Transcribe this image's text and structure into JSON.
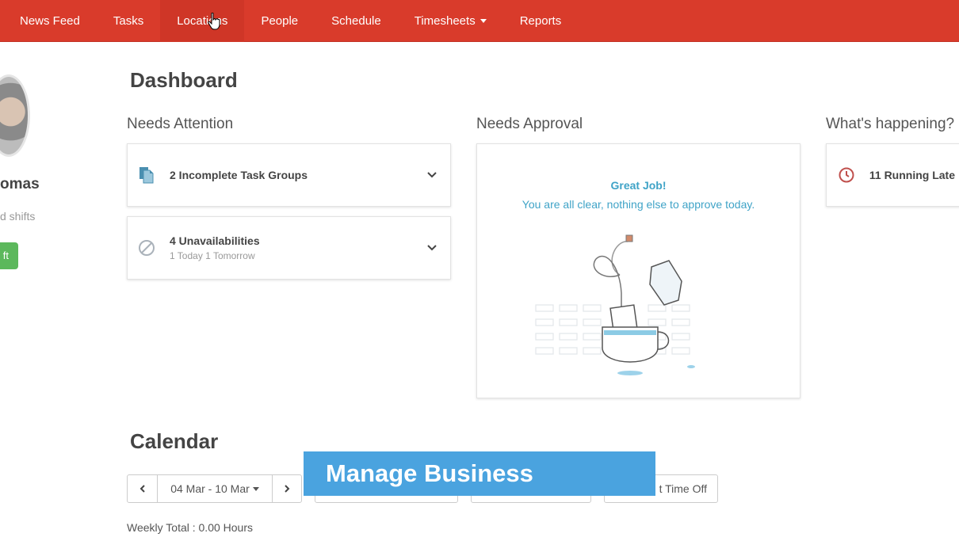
{
  "nav": {
    "items": [
      {
        "label": "News Feed"
      },
      {
        "label": "Tasks"
      },
      {
        "label": "Locations"
      },
      {
        "label": "People"
      },
      {
        "label": "Schedule"
      },
      {
        "label": "Timesheets"
      },
      {
        "label": "Reports"
      }
    ],
    "active": "Locations",
    "accent_color": "#d93b2b"
  },
  "profile": {
    "name_fragment": "omas",
    "sub_fragment": "d shifts",
    "button_fragment": "ft"
  },
  "dashboard": {
    "title": "Dashboard",
    "needs_attention": {
      "heading": "Needs Attention",
      "items": [
        {
          "title": "2 Incomplete Task Groups",
          "sub": "",
          "icon": "document-icon"
        },
        {
          "title": "4 Unavailabilities",
          "sub": "1 Today 1 Tomorrow",
          "icon": "prohibited-icon"
        }
      ]
    },
    "needs_approval": {
      "heading": "Needs Approval",
      "title": "Great Job!",
      "message": "You are all clear, nothing else to approve today."
    },
    "whats_happening": {
      "heading": "What's happening?",
      "items": [
        {
          "title": "11 Running Late",
          "icon": "clock-icon"
        }
      ]
    }
  },
  "calendar": {
    "title": "Calendar",
    "date_range": "04 Mar - 10 Mar",
    "time_off_fragment": "t Time Off",
    "weekly_total": "Weekly Total : 0.00 Hours"
  },
  "overlay": {
    "caption": "Manage Business Locations",
    "color": "#4aa3df"
  }
}
